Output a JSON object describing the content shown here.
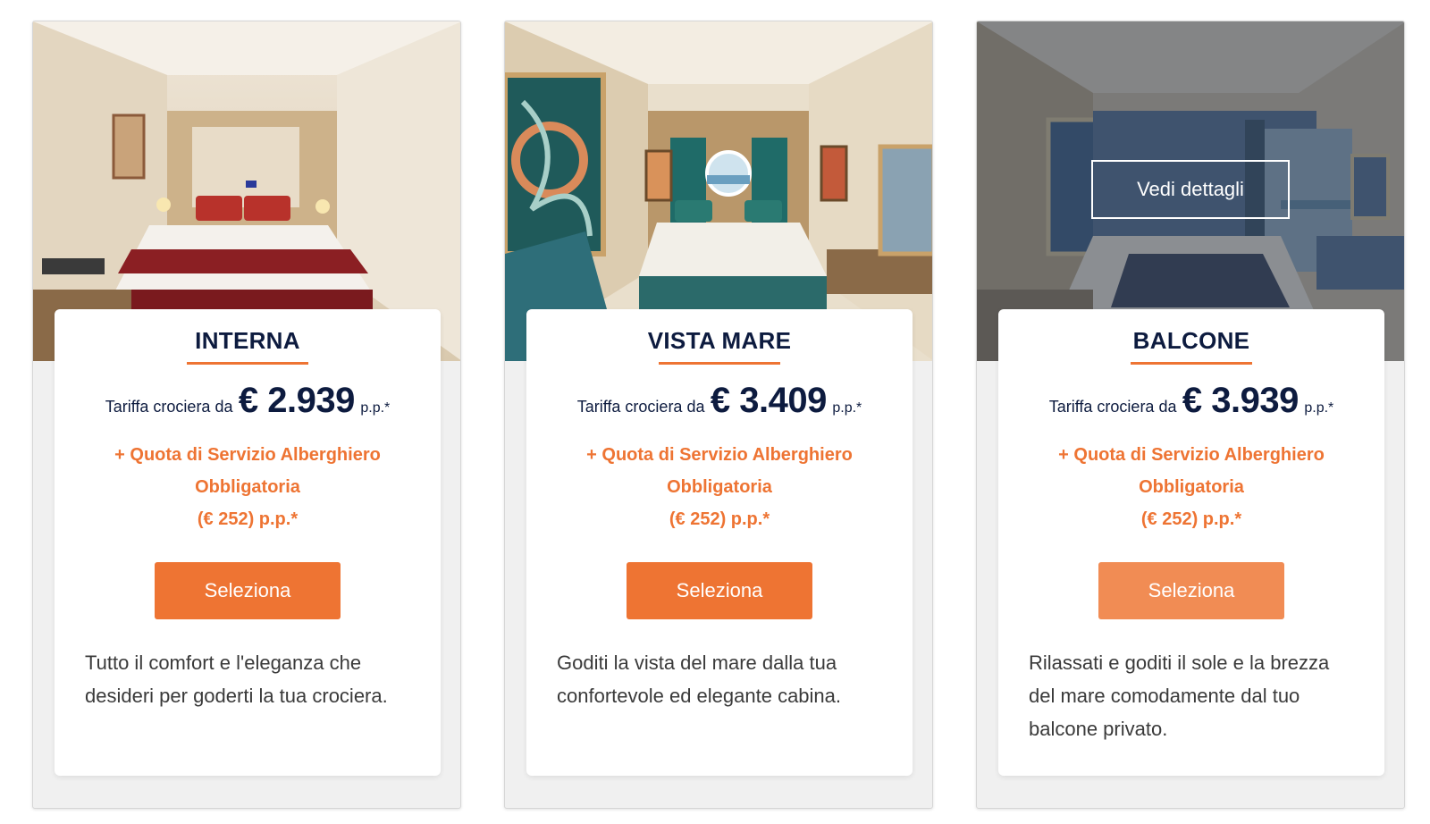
{
  "cabins": [
    {
      "title": "INTERNA",
      "fare_label": "Tariffa crociera da",
      "price": "€ 2.939",
      "pp": "p.p.*",
      "fee_line1": "+ Quota di Servizio Alberghiero",
      "fee_line2": "Obbligatoria",
      "fee_line3": "(€ 252) p.p.*",
      "button_label": "Seleziona",
      "description": "Tutto il comfort e l'eleganza che desideri per goderti la tua crociera."
    },
    {
      "title": "VISTA MARE",
      "fare_label": "Tariffa crociera da",
      "price": "€ 3.409",
      "pp": "p.p.*",
      "fee_line1": "+ Quota di Servizio Alberghiero",
      "fee_line2": "Obbligatoria",
      "fee_line3": "(€ 252) p.p.*",
      "button_label": "Seleziona",
      "description": "Goditi la vista del mare dalla tua confortevole ed elegante cabina."
    },
    {
      "title": "BALCONE",
      "fare_label": "Tariffa crociera da",
      "price": "€ 3.939",
      "pp": "p.p.*",
      "fee_line1": "+ Quota di Servizio Alberghiero",
      "fee_line2": "Obbligatoria",
      "fee_line3": "(€ 252) p.p.*",
      "button_label": "Seleziona",
      "description": "Rilassati e goditi il sole e la brezza del mare comodamente dal tuo balcone privato.",
      "details_label": "Vedi dettagli"
    }
  ],
  "colors": {
    "accent": "#ee7433",
    "accent_hover": "#f18c54",
    "navy": "#0d1b3f",
    "card_bg": "#f0f0f0"
  }
}
